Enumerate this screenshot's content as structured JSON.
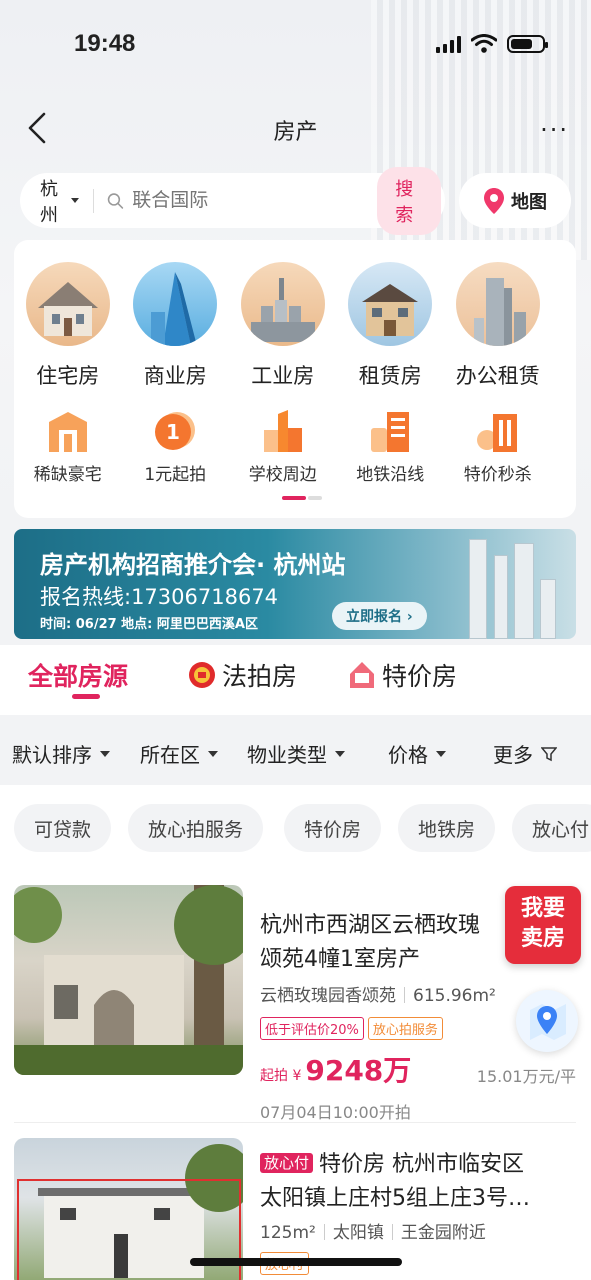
{
  "status": {
    "time": "19:48"
  },
  "nav": {
    "title": "房产",
    "more": "···"
  },
  "search": {
    "city": "杭州",
    "placeholder": "联合国际",
    "button": "搜索",
    "map": "地图"
  },
  "categories_main": [
    {
      "label": "住宅房",
      "icon": "house-icon",
      "color": "#f2c9a2"
    },
    {
      "label": "商业房",
      "icon": "office-tower-icon",
      "color": "#7fc0ea"
    },
    {
      "label": "工业房",
      "icon": "factory-icon",
      "color": "#f0c7a0"
    },
    {
      "label": "租赁房",
      "icon": "villa-icon",
      "color": "#bcd8ec"
    },
    {
      "label": "办公租赁",
      "icon": "skyscraper-icon",
      "color": "#f3d2b5"
    }
  ],
  "categories_secondary": [
    {
      "label": "稀缺豪宅",
      "icon": "mansion-icon"
    },
    {
      "label": "1元起拍",
      "icon": "coin-icon"
    },
    {
      "label": "学校周边",
      "icon": "school-icon"
    },
    {
      "label": "地铁沿线",
      "icon": "metro-icon"
    },
    {
      "label": "特价秒杀",
      "icon": "flash-sale-icon"
    }
  ],
  "banner": {
    "title": "房产机构招商推介会· 杭州站",
    "phone": "报名热线:17306718674",
    "meta": "时间: 06/27   地点: 阿里巴巴西溪A区",
    "button": "立即报名 ›"
  },
  "tabs": [
    {
      "label": "全部房源",
      "active": true
    },
    {
      "label": "法拍房",
      "icon": "court-badge-icon"
    },
    {
      "label": "特价房",
      "icon": "special-price-icon"
    }
  ],
  "filters": [
    {
      "label": "默认排序"
    },
    {
      "label": "所在区"
    },
    {
      "label": "物业类型"
    },
    {
      "label": "价格"
    },
    {
      "label": "更多"
    }
  ],
  "chips": [
    "可贷款",
    "放心拍服务",
    "特价房",
    "地铁房",
    "放心付"
  ],
  "listings": [
    {
      "title": "杭州市西湖区云栖玫瑰园香颂苑4幢1室房产",
      "title_line1": "杭州市西湖区云栖玫瑰",
      "title_line2": "颂苑4幢1室房产",
      "community": "云栖玫瑰园香颂苑",
      "area": "615.96m²",
      "tag1": "低于评估价20%",
      "tag2": "放心拍服务",
      "price_prefix": "起拍 ¥",
      "price": "9248万",
      "unit_price": "15.01万元/平",
      "time": "07月04日10:00开拍"
    },
    {
      "badge": "放心付",
      "title_line1": "特价房 杭州市临安区",
      "title_line2": "太阳镇上庄村5组上庄3号…",
      "area": "125m²",
      "town": "太阳镇",
      "nearby": "王金园附近",
      "tag1": "放心付"
    }
  ],
  "floating": {
    "sell_line1": "我要",
    "sell_line2": "卖房"
  },
  "colors": {
    "accent": "#e0245e",
    "orange": "#f28c38",
    "banner": "#1d6e87"
  }
}
